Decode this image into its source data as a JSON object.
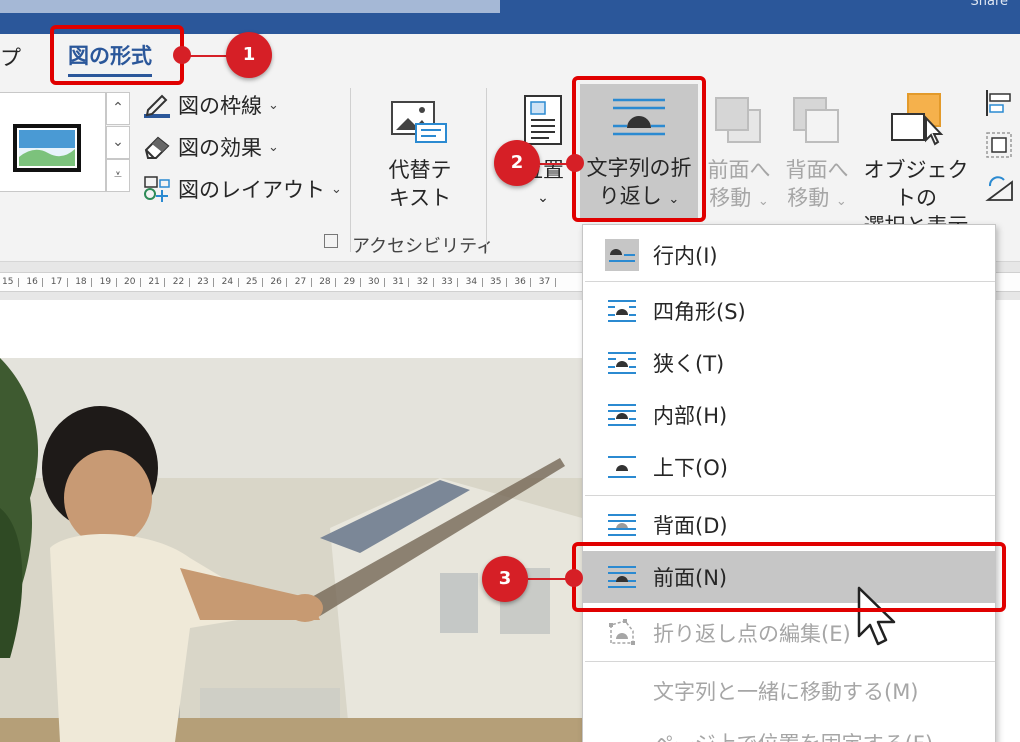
{
  "title_bar": {
    "share_fragment": "Share"
  },
  "tabs": {
    "previous_fragment": "プ",
    "active": "図の形式"
  },
  "picture_styles": {
    "commands": [
      {
        "label": "図の枠線",
        "icon": "pen-border-icon"
      },
      {
        "label": "図の効果",
        "icon": "eraser-effect-icon"
      },
      {
        "label": "図のレイアウト",
        "icon": "picture-layout-icon"
      }
    ]
  },
  "accessibility": {
    "alt_text": {
      "line1": "代替テ",
      "line2": "キスト"
    },
    "group_label": "アクセシビリティ"
  },
  "arrange": {
    "position": {
      "label": "位置"
    },
    "wrap_text": {
      "line1": "文字列の折",
      "line2": "り返し"
    },
    "bring_forward": {
      "line1": "前面へ",
      "line2": "移動"
    },
    "send_backward": {
      "line1": "背面へ",
      "line2": "移動"
    },
    "selection_pane": {
      "line1": "オブジェクトの",
      "line2": "選択と表示"
    }
  },
  "ruler": {
    "ticks": [
      "15",
      "16",
      "17",
      "18",
      "19",
      "20",
      "21",
      "22",
      "23",
      "24",
      "25",
      "26",
      "27",
      "28",
      "29",
      "30",
      "31",
      "32",
      "33",
      "34",
      "35",
      "36",
      "37"
    ]
  },
  "wrap_menu": {
    "items": [
      {
        "label": "行内(I)",
        "icon": "inline-with-text-icon",
        "enabled": true
      },
      {
        "label": "四角形(S)",
        "icon": "square-wrap-icon",
        "enabled": true
      },
      {
        "label": "狭く(T)",
        "icon": "tight-wrap-icon",
        "enabled": true
      },
      {
        "label": "内部(H)",
        "icon": "through-wrap-icon",
        "enabled": true
      },
      {
        "label": "上下(O)",
        "icon": "top-bottom-wrap-icon",
        "enabled": true
      },
      {
        "label": "背面(D)",
        "icon": "behind-text-icon",
        "enabled": true
      },
      {
        "label": "前面(N)",
        "icon": "in-front-of-text-icon",
        "enabled": true,
        "highlighted": true
      },
      {
        "label": "折り返し点の編集(E)",
        "icon": "edit-wrap-points-icon",
        "enabled": false
      },
      {
        "label": "文字列と一緒に移動する(M)",
        "enabled": false
      },
      {
        "label": "ページ上で位置を固定する(F)",
        "enabled": false
      }
    ]
  },
  "callouts": [
    "1",
    "2",
    "3"
  ],
  "colors": {
    "word_blue": "#2b579a",
    "callout_red": "#d61f26",
    "highlight_gray": "#c6c6c6"
  }
}
